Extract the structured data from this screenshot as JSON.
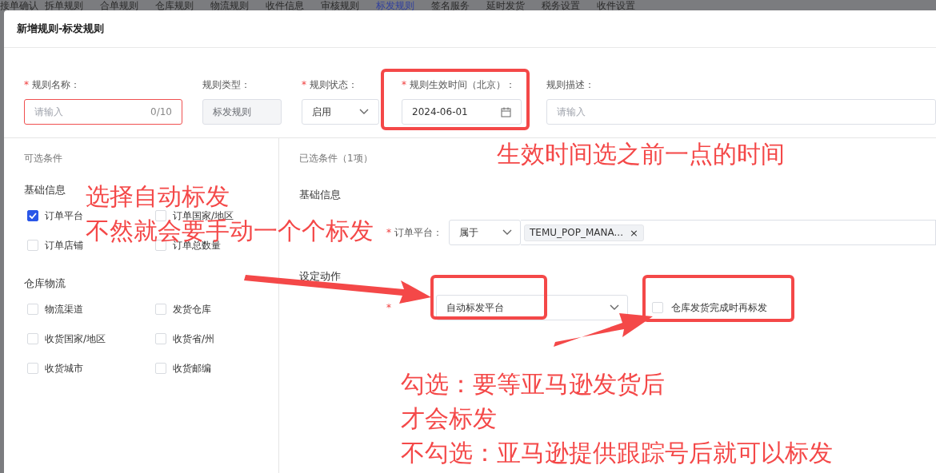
{
  "background_tabs": [
    {
      "label": "接单确认",
      "selected": false
    },
    {
      "label": "拆单规则",
      "selected": false
    },
    {
      "label": "合单规则",
      "selected": false
    },
    {
      "label": "仓库规则",
      "selected": false
    },
    {
      "label": "物流规则",
      "selected": false
    },
    {
      "label": "收件信息",
      "selected": false
    },
    {
      "label": "审核规则",
      "selected": false
    },
    {
      "label": "标发规则",
      "selected": true
    },
    {
      "label": "签名服务",
      "selected": false
    },
    {
      "label": "延时发货",
      "selected": false
    },
    {
      "label": "税务设置",
      "selected": false
    },
    {
      "label": "收件设置",
      "selected": false
    }
  ],
  "required_mark": "*",
  "dialog": {
    "title": "新增规则-标发规则"
  },
  "form_fields": [
    {
      "kind": "text",
      "label": "规则名称：",
      "required": true,
      "placeholder": "请输入",
      "counter": "0/10",
      "error": true
    },
    {
      "kind": "readonly",
      "label": "规则类型：",
      "required": false,
      "value": "标发规则"
    },
    {
      "kind": "select",
      "label": "规则状态：",
      "required": true,
      "value": "启用"
    },
    {
      "kind": "date",
      "label": "规则生效时间（北京）：",
      "required": true,
      "value": "2024-06-01"
    },
    {
      "kind": "text",
      "label": "规则描述：",
      "required": false,
      "placeholder": "请输入",
      "error": false
    }
  ],
  "available_conditions": {
    "title": "可选条件",
    "groups": [
      {
        "title": "基础信息",
        "items": [
          {
            "label": "订单平台",
            "checked": true
          },
          {
            "label": "订单国家/地区",
            "checked": false
          },
          {
            "label": "订单店铺",
            "checked": false
          },
          {
            "label": "订单总数量",
            "checked": false
          }
        ]
      },
      {
        "title": "仓库物流",
        "items": [
          {
            "label": "物流渠道",
            "checked": false
          },
          {
            "label": "发货仓库",
            "checked": false
          },
          {
            "label": "收货国家/地区",
            "checked": false
          },
          {
            "label": "收货省/州",
            "checked": false
          },
          {
            "label": "收货城市",
            "checked": false
          },
          {
            "label": "收货邮编",
            "checked": false
          }
        ]
      }
    ]
  },
  "selected_conditions": {
    "title": "已选条件（1项）",
    "group_title": "基础信息",
    "conditions": [
      {
        "label": "订单平台：",
        "required": true,
        "operator": "属于",
        "tags": [
          "TEMU_POP_MANA..."
        ],
        "tag_close": "×"
      }
    ]
  },
  "action": {
    "title": "设定动作",
    "required": true,
    "value": "自动标发平台",
    "checkbox": {
      "label": "仓库发货完成时再标发",
      "checked": false
    }
  },
  "annotations": [
    {
      "lines": [
        "生效时间选之前一点的时间"
      ]
    },
    {
      "lines": [
        "选择自动标发",
        "不然就会要手动一个个标发"
      ]
    },
    {
      "lines": [
        "勾选：要等亚马逊发货后",
        "才会标发",
        "不勾选：亚马逊提供跟踪号后就可以标发"
      ]
    }
  ]
}
